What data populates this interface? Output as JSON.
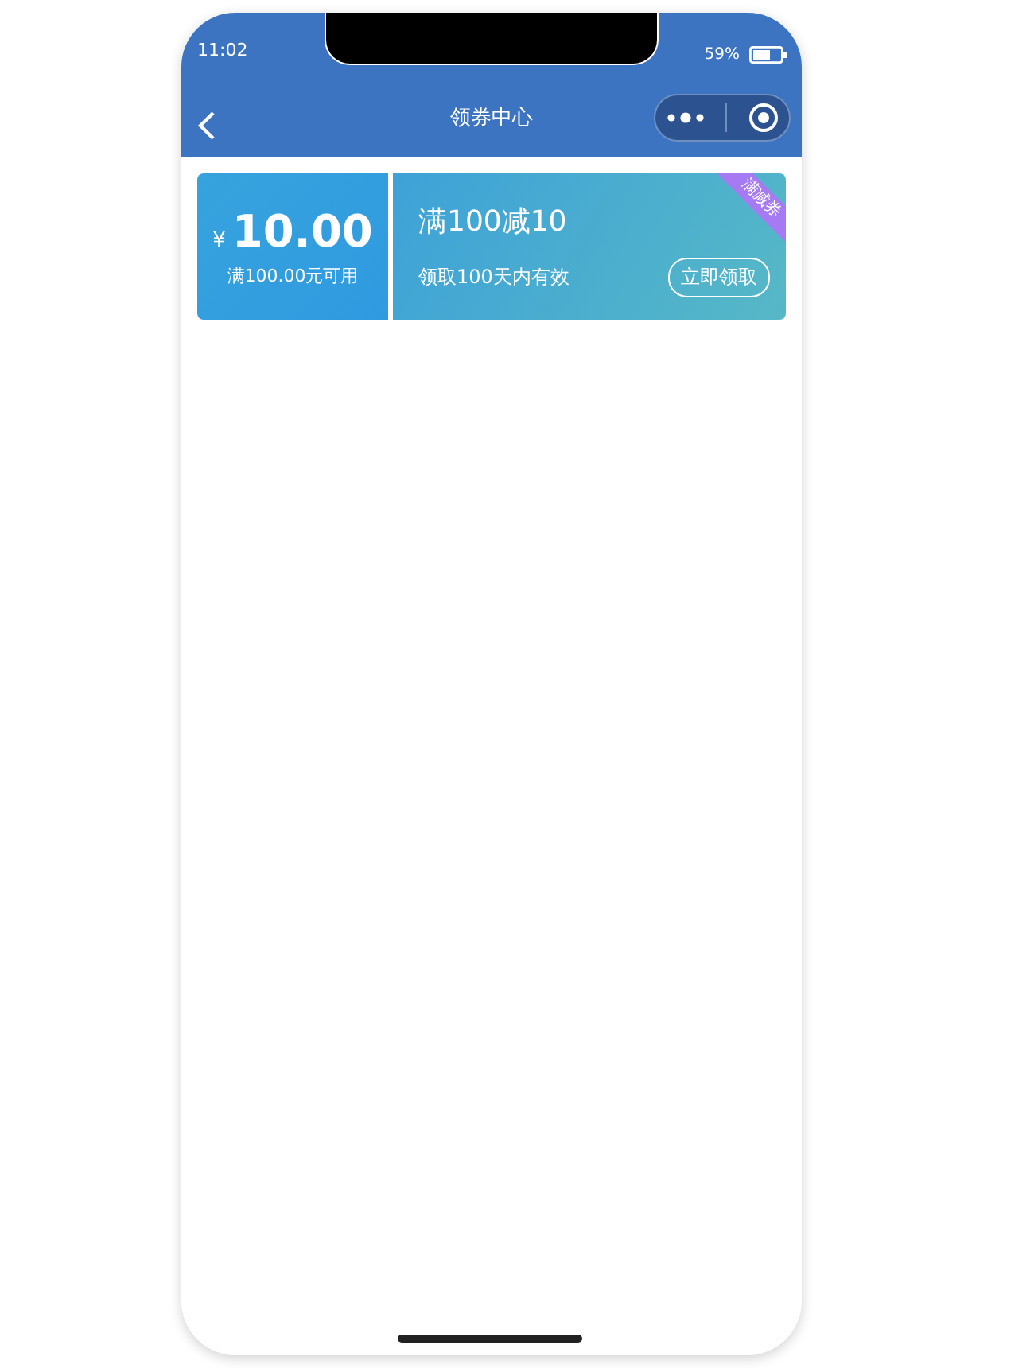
{
  "status_bar": {
    "time": "11:02",
    "battery": "59%"
  },
  "nav_bar": {
    "title": "领券中心"
  },
  "coupons": [
    {
      "symbol": "¥",
      "amount": "10.00",
      "condition": "满100.00元可用",
      "title": "满100减10",
      "validity": "领取100天内有效",
      "button": "立即领取",
      "tag": "满减券"
    }
  ]
}
